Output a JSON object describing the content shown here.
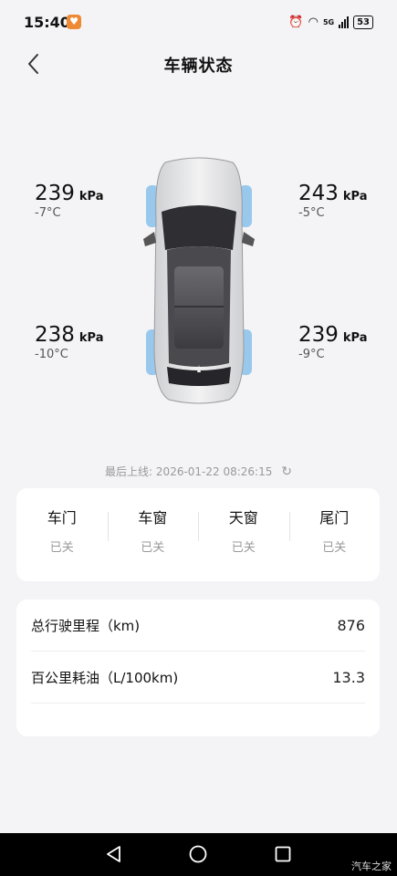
{
  "status": {
    "time": "15:40",
    "net": "5G",
    "battery": "53"
  },
  "header": {
    "title": "车辆状态"
  },
  "tires": {
    "front_left": {
      "pressure": "239",
      "unit": "kPa",
      "temp": "-7°C"
    },
    "front_right": {
      "pressure": "243",
      "unit": "kPa",
      "temp": "-5°C"
    },
    "rear_left": {
      "pressure": "238",
      "unit": "kPa",
      "temp": "-10°C"
    },
    "rear_right": {
      "pressure": "239",
      "unit": "kPa",
      "temp": "-9°C"
    }
  },
  "last_online": {
    "label": "最后上线:",
    "value": "2026-01-22 08:26:15"
  },
  "openings": [
    {
      "label": "车门",
      "state": "已关"
    },
    {
      "label": "车窗",
      "state": "已关"
    },
    {
      "label": "天窗",
      "state": "已关"
    },
    {
      "label": "尾门",
      "state": "已关"
    }
  ],
  "stats": [
    {
      "label": "总行驶里程（km)",
      "value": "876"
    },
    {
      "label": "百公里耗油（L/100km)",
      "value": "13.3"
    }
  ],
  "watermark": "汽车之家",
  "colors": {
    "tire_highlight": "#8ec4ec",
    "accent": "#ee8a35"
  }
}
